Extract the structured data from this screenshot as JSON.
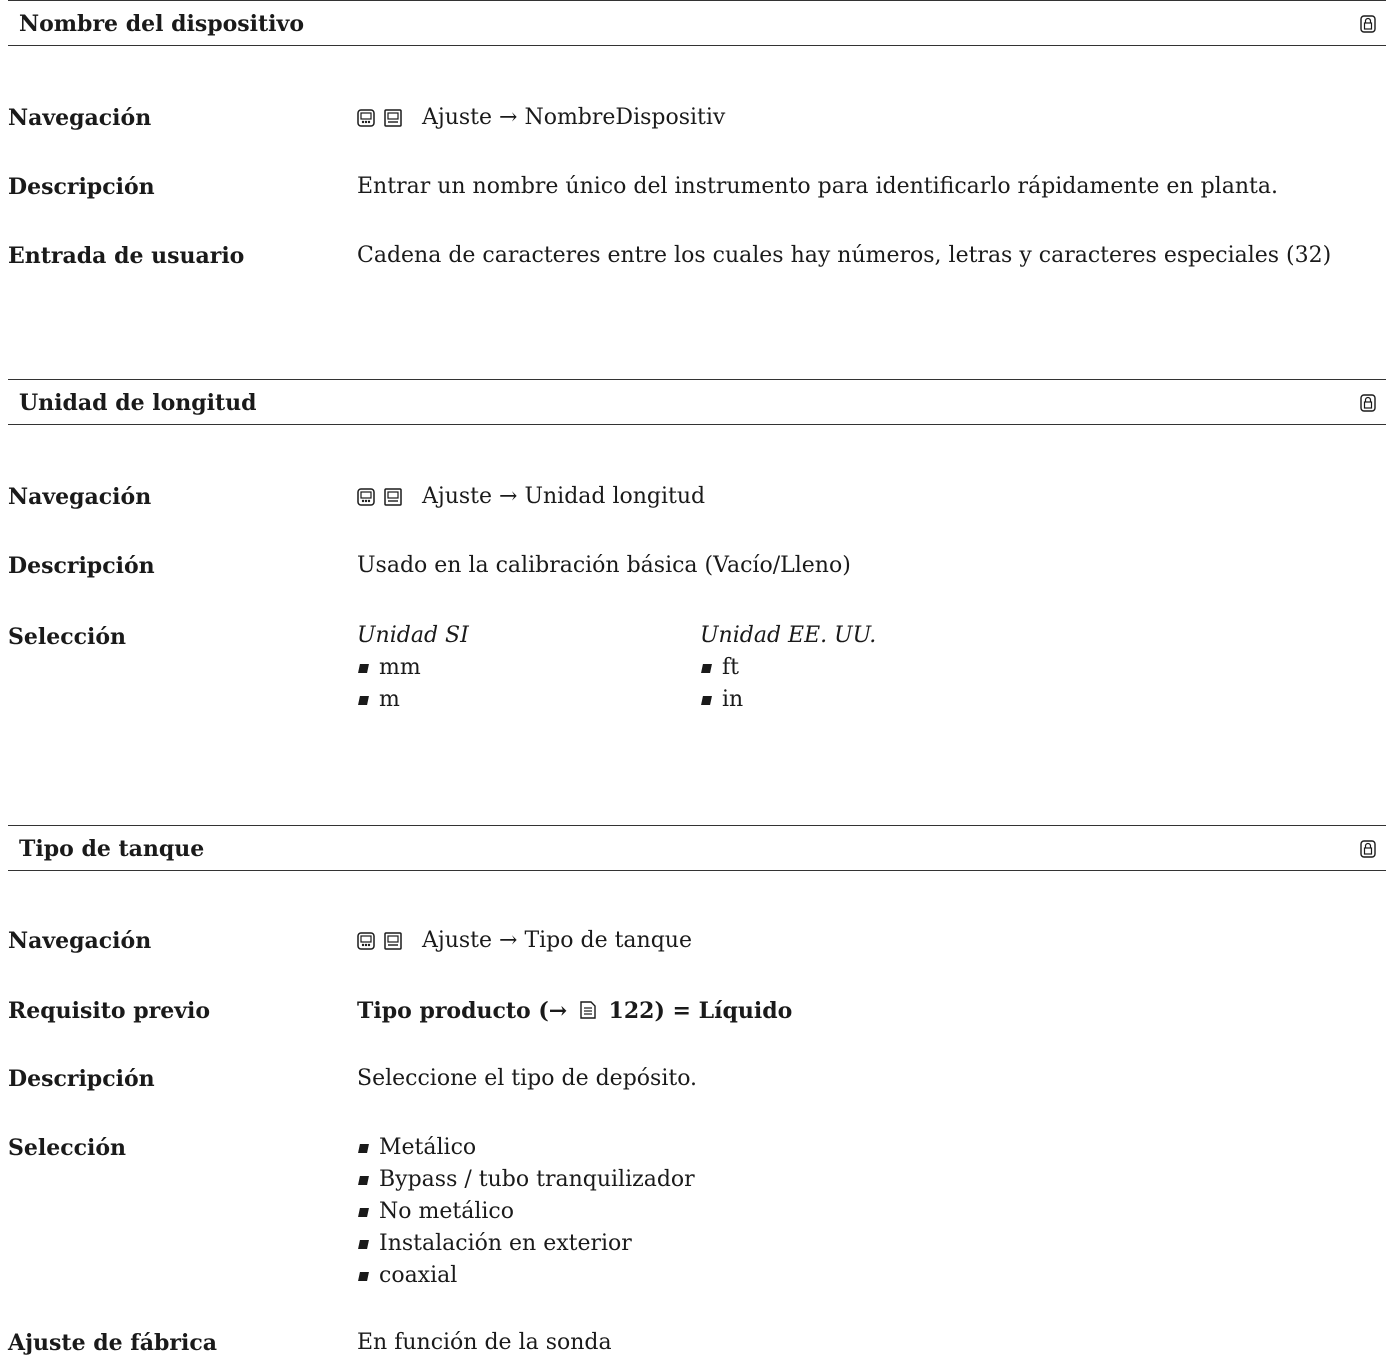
{
  "sections": [
    {
      "title": "Nombre del dispositivo",
      "navigation_label": "Navegación",
      "navigation_path": "Ajuste → NombreDispositiv",
      "description_label": "Descripción",
      "description": "Entrar un nombre único del instrumento para identificarlo rápidamente en planta.",
      "input_label": "Entrada de usuario",
      "input_text": "Cadena de caracteres entre los cuales hay números, letras y caracteres especiales (32)"
    },
    {
      "title": "Unidad de longitud",
      "navigation_label": "Navegación",
      "navigation_path": "Ajuste → Unidad longitud",
      "description_label": "Descripción",
      "description": "Usado en la calibración básica (Vacío/Lleno)",
      "selection_label": "Selección",
      "groups": [
        {
          "heading": "Unidad SI",
          "items": [
            "mm",
            "m"
          ]
        },
        {
          "heading": "Unidad EE. UU.",
          "items": [
            "ft",
            "in"
          ]
        }
      ]
    },
    {
      "title": "Tipo de tanque",
      "navigation_label": "Navegación",
      "navigation_path": "Ajuste → Tipo de tanque",
      "prerequisite_label": "Requisito previo",
      "prerequisite_pre": "Tipo producto (→",
      "prerequisite_page": "122) = Líquido",
      "description_label": "Descripción",
      "description": "Seleccione el tipo de depósito.",
      "selection_label": "Selección",
      "items": [
        "Metálico",
        "Bypass / tubo tranquilizador",
        "No metálico",
        "Instalación en exterior",
        "coaxial"
      ],
      "factory_label": "Ajuste de fábrica",
      "factory_value": "En función de la sonda"
    }
  ]
}
